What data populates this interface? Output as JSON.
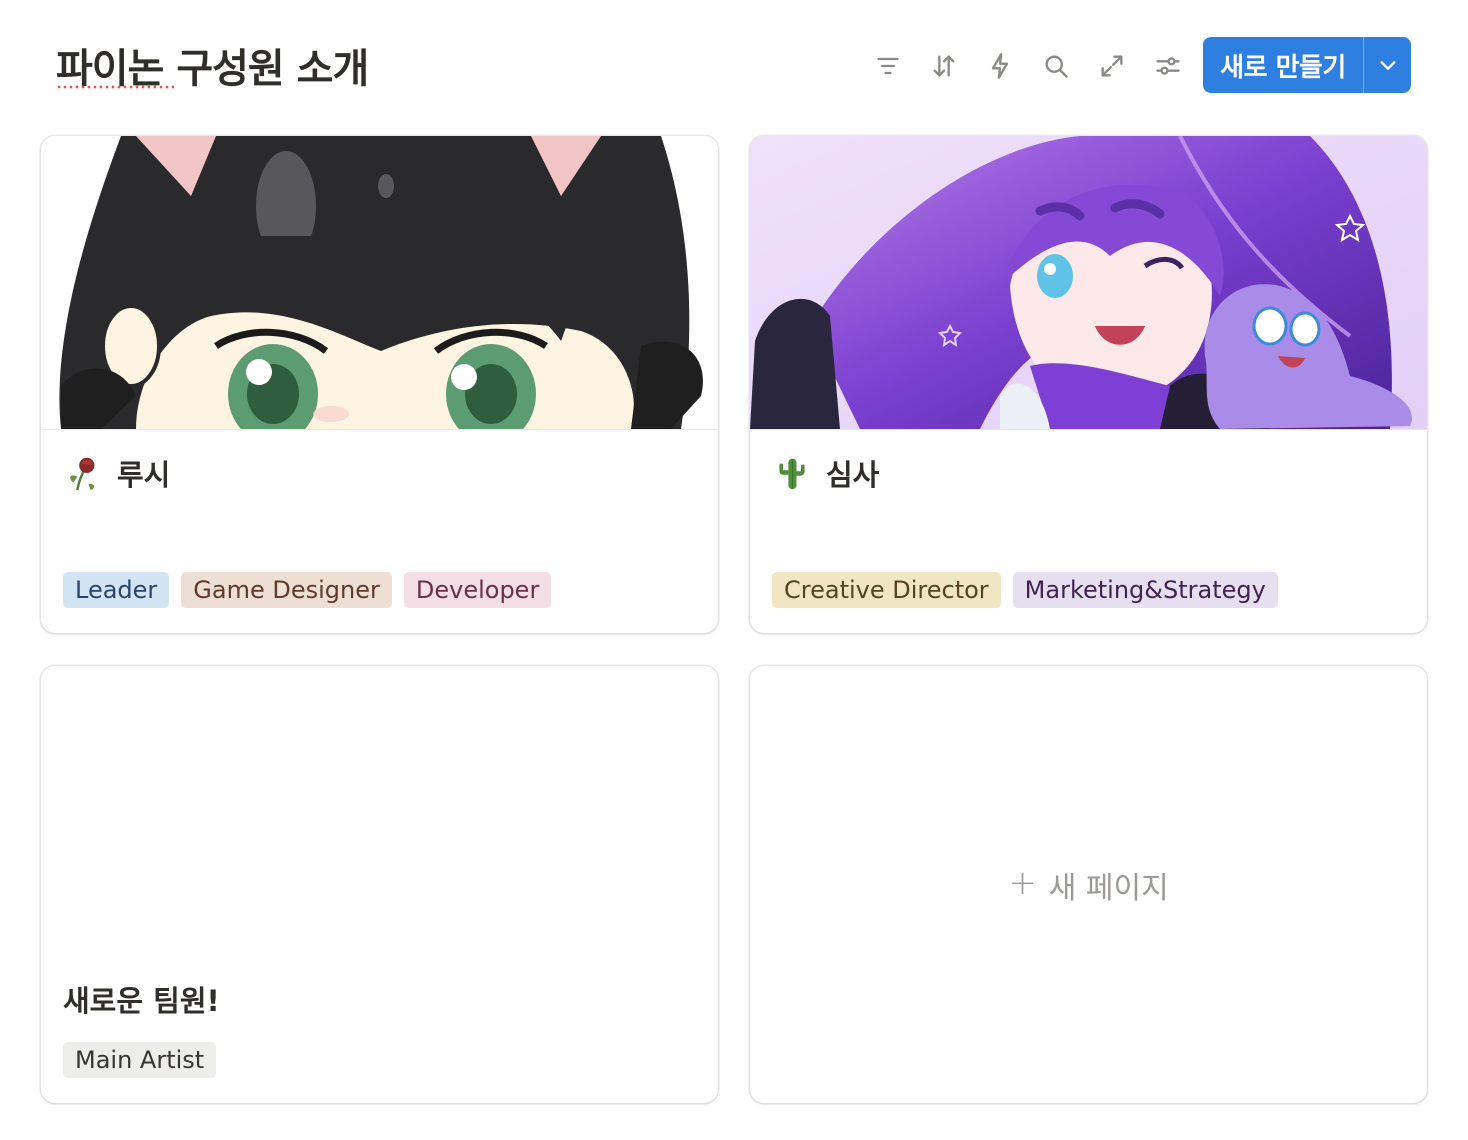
{
  "header": {
    "title": "파이논 구성원 소개",
    "toolbar_icons": [
      "filter-icon",
      "sort-icon",
      "lightning-icon",
      "search-icon",
      "expand-icon",
      "settings-sliders-icon"
    ],
    "new_button_label": "새로 만들기"
  },
  "cards": [
    {
      "title": "루시",
      "emoji": "wilted-rose",
      "tags": [
        {
          "label": "Leader",
          "bg": "#d3e5f5",
          "fg": "#28456c"
        },
        {
          "label": "Game Designer",
          "bg": "#eddfd4",
          "fg": "#603b2c"
        },
        {
          "label": "Developer",
          "bg": "#f4dfe6",
          "fg": "#69314c"
        }
      ]
    },
    {
      "title": "심사",
      "emoji": "cactus",
      "tags": [
        {
          "label": "Creative Director",
          "bg": "#f0e6c4",
          "fg": "#574323"
        },
        {
          "label": "Marketing&Strategy",
          "bg": "#e6dff0",
          "fg": "#412454"
        }
      ]
    },
    {
      "title": "새로운 팀원!",
      "tags": [
        {
          "label": "Main Artist",
          "bg": "#ededec",
          "fg": "#37352f"
        }
      ]
    }
  ],
  "new_page": {
    "plus": "+",
    "label": "새 페이지"
  },
  "colors": {
    "accent": "#2f7fe0",
    "text": "#37352f",
    "muted": "#9b9a97"
  }
}
